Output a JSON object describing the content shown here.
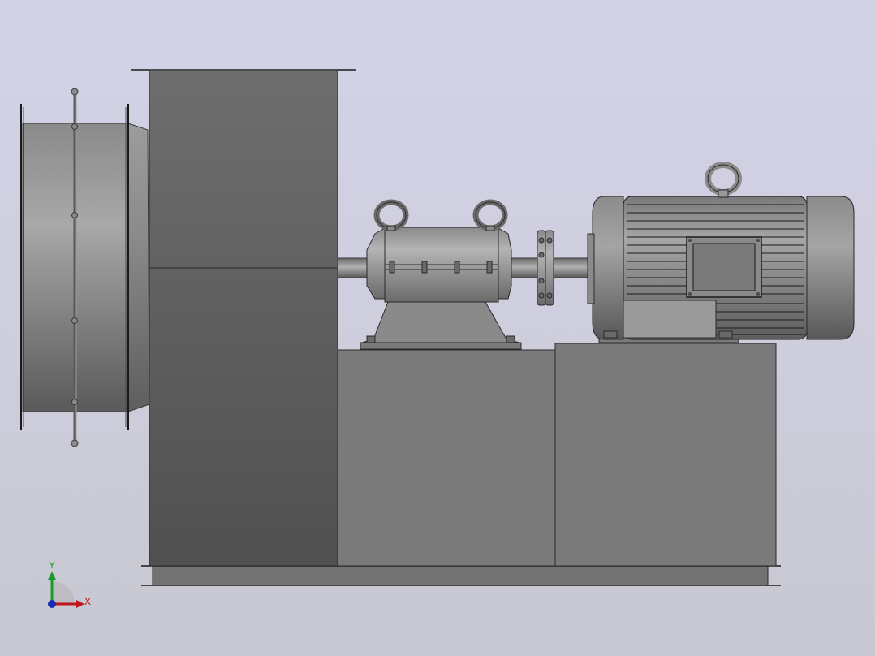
{
  "viewport": {
    "background_top": "#d3d3e8",
    "background_bottom": "#c8c8d2"
  },
  "triad": {
    "x_label": "X",
    "y_label": "Y",
    "x_color": "#c0141c",
    "y_color": "#1a9a2a",
    "z_color": "#1a2ab4"
  },
  "model": {
    "description_icon": "cad-model-icon"
  }
}
